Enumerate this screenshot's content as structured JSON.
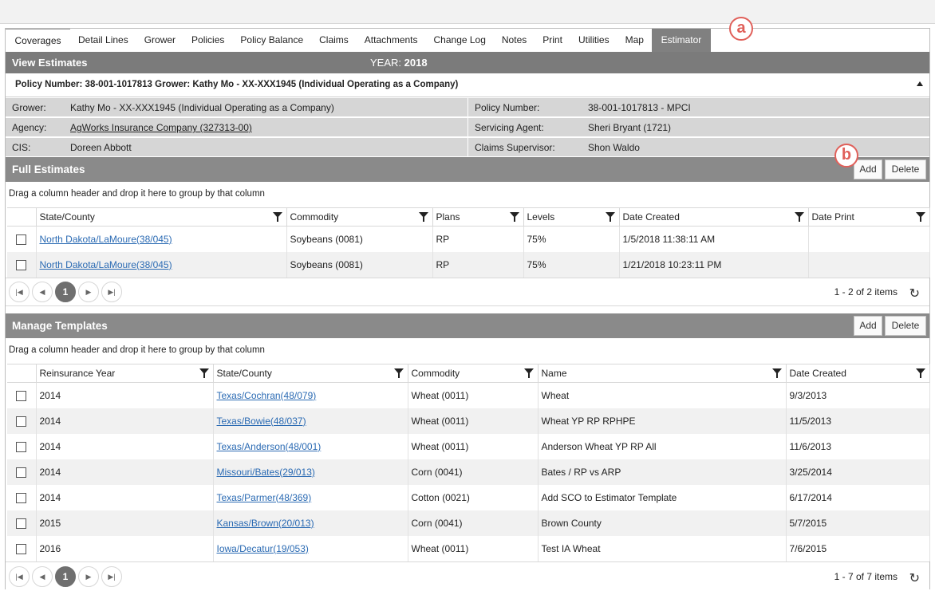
{
  "tabs": [
    "Coverages",
    "Detail Lines",
    "Grower",
    "Policies",
    "Policy Balance",
    "Claims",
    "Attachments",
    "Change Log",
    "Notes",
    "Print",
    "Utilities",
    "Map",
    "Estimator"
  ],
  "active_tab": "Estimator",
  "badges": {
    "a": "a",
    "b": "b"
  },
  "view": {
    "title": "View Estimates",
    "year_label": "YEAR:",
    "year": "2018"
  },
  "policy_header": "Policy Number: 38-001-1017813 Grower: Kathy Mo - XX-XXX1945 (Individual Operating as a Company)",
  "info": {
    "grower_label": "Grower:",
    "grower": "Kathy Mo - XX-XXX1945 (Individual Operating as a Company)",
    "agency_label": "Agency:",
    "agency": "AgWorks Insurance Company (327313-00)",
    "cis_label": "CIS:",
    "cis": "Doreen Abbott",
    "policy_label": "Policy Number:",
    "policy": "38-001-1017813 - MPCI",
    "agent_label": "Servicing Agent:",
    "agent": "Sheri Bryant (1721)",
    "supervisor_label": "Claims Supervisor:",
    "supervisor": "Shon Waldo"
  },
  "full_estimates": {
    "title": "Full Estimates",
    "add": "Add",
    "delete": "Delete",
    "drag_tip": "Drag a column header and drop it here to group by that column",
    "columns": [
      "State/County",
      "Commodity",
      "Plans",
      "Levels",
      "Date Created",
      "Date Print"
    ],
    "rows": [
      {
        "state": "North Dakota/LaMoure(38/045)",
        "commodity": "Soybeans (0081)",
        "plans": "RP",
        "levels": "75%",
        "created": "1/5/2018 11:38:11 AM",
        "printed": ""
      },
      {
        "state": "North Dakota/LaMoure(38/045)",
        "commodity": "Soybeans (0081)",
        "plans": "RP",
        "levels": "75%",
        "created": "1/21/2018 10:23:11 PM",
        "printed": ""
      }
    ],
    "page": "1",
    "items": "1 - 2 of 2 items"
  },
  "templates": {
    "title": "Manage Templates",
    "add": "Add",
    "delete": "Delete",
    "drag_tip": "Drag a column header and drop it here to group by that column",
    "columns": [
      "Reinsurance Year",
      "State/County",
      "Commodity",
      "Name",
      "Date Created"
    ],
    "rows": [
      {
        "year": "2014",
        "state": "Texas/Cochran(48/079)",
        "commodity": "Wheat (0011)",
        "name": "Wheat",
        "created": "9/3/2013"
      },
      {
        "year": "2014",
        "state": "Texas/Bowie(48/037)",
        "commodity": "Wheat (0011)",
        "name": "Wheat YP RP RPHPE",
        "created": "11/5/2013"
      },
      {
        "year": "2014",
        "state": "Texas/Anderson(48/001)",
        "commodity": "Wheat (0011)",
        "name": "Anderson Wheat YP RP All",
        "created": "11/6/2013"
      },
      {
        "year": "2014",
        "state": "Missouri/Bates(29/013)",
        "commodity": "Corn (0041)",
        "name": "Bates / RP vs ARP",
        "created": "3/25/2014"
      },
      {
        "year": "2014",
        "state": "Texas/Parmer(48/369)",
        "commodity": "Cotton (0021)",
        "name": "Add SCO to Estimator Template",
        "created": "6/17/2014"
      },
      {
        "year": "2015",
        "state": "Kansas/Brown(20/013)",
        "commodity": "Corn (0041)",
        "name": "Brown County",
        "created": "5/7/2015"
      },
      {
        "year": "2016",
        "state": "Iowa/Decatur(19/053)",
        "commodity": "Wheat (0011)",
        "name": "Test IA Wheat",
        "created": "7/6/2015"
      }
    ],
    "page": "1",
    "items": "1 - 7 of 7 items"
  }
}
